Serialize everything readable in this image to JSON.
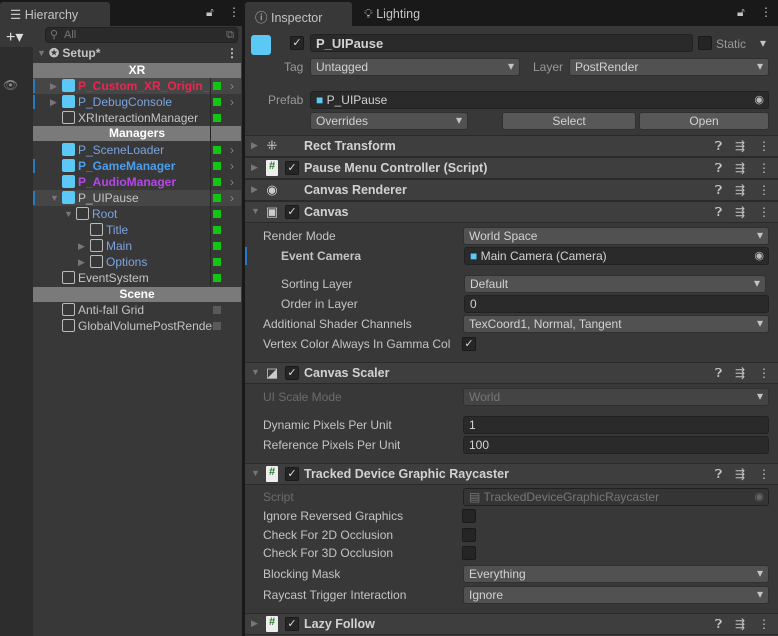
{
  "hierarchy": {
    "tab": "Hierarchy",
    "search_placeholder": "All",
    "scene": "Setup*",
    "groups": {
      "xr": "XR",
      "managers": "Managers",
      "scene": "Scene"
    },
    "items": [
      {
        "label": "P_Custom_XR_Origin_",
        "color": "#e8284f"
      },
      {
        "label": "P_DebugConsole",
        "color": "#7ba4e0"
      },
      {
        "label": "XRInteractionManager",
        "color": "#c4c4c4"
      },
      {
        "label": "P_SceneLoader",
        "color": "#7ba4e0"
      },
      {
        "label": "P_GameManager",
        "color": "#4a9ff0"
      },
      {
        "label": "P_AudioManager",
        "color": "#b547e8"
      },
      {
        "label": "P_UIPause",
        "color": "#c4c4c4"
      },
      {
        "label": "Root",
        "color": "#7ba4e0"
      },
      {
        "label": "Title",
        "color": "#7ba4e0"
      },
      {
        "label": "Main",
        "color": "#7ba4e0"
      },
      {
        "label": "Options",
        "color": "#7ba4e0"
      },
      {
        "label": "EventSystem",
        "color": "#c4c4c4"
      },
      {
        "label": "Anti-fall Grid",
        "color": "#c4c4c4"
      },
      {
        "label": "GlobalVolumePostRender",
        "color": "#c4c4c4"
      }
    ]
  },
  "inspector": {
    "tabs": [
      "Inspector",
      "Lighting"
    ],
    "name": "P_UIPause",
    "static_label": "Static",
    "tag_label": "Tag",
    "tag": "Untagged",
    "layer_label": "Layer",
    "layer": "PostRender",
    "prefab_label": "Prefab",
    "prefab": "P_UIPause",
    "overrides": "Overrides",
    "select": "Select",
    "open": "Open",
    "components": {
      "rect": "Rect Transform",
      "pause": "Pause Menu Controller (Script)",
      "renderer": "Canvas Renderer",
      "canvas": "Canvas",
      "scaler": "Canvas Scaler",
      "raycaster": "Tracked Device Graphic Raycaster",
      "lazy": "Lazy Follow"
    },
    "canvas": {
      "render_mode_label": "Render Mode",
      "render_mode": "World Space",
      "event_camera_label": "Event Camera",
      "event_camera": "Main Camera (Camera)",
      "sorting_layer_label": "Sorting Layer",
      "sorting_layer": "Default",
      "order_label": "Order in Layer",
      "order": "0",
      "shader_label": "Additional Shader Channels",
      "shader": "TexCoord1, Normal, Tangent",
      "vertex_label": "Vertex Color Always In Gamma Col"
    },
    "scaler": {
      "mode_label": "UI Scale Mode",
      "mode": "World",
      "dynamic_label": "Dynamic Pixels Per Unit",
      "dynamic": "1",
      "ref_label": "Reference Pixels Per Unit",
      "ref": "100"
    },
    "raycaster": {
      "script_label": "Script",
      "script": "TrackedDeviceGraphicRaycaster",
      "ignore_reversed": "Ignore Reversed Graphics",
      "check2d": "Check For 2D Occlusion",
      "check3d": "Check For 3D Occlusion",
      "mask_label": "Blocking Mask",
      "mask": "Everything",
      "trigger_label": "Raycast Trigger Interaction",
      "trigger": "Ignore"
    }
  }
}
